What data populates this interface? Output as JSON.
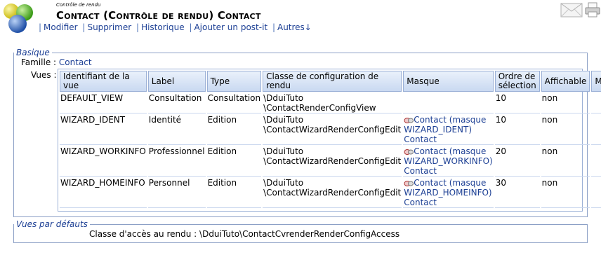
{
  "header": {
    "category": "Contrôle de rendu",
    "title": "Contact (Contrôle de rendu) Contact"
  },
  "menu": [
    "Modifier",
    "Supprimer",
    "Historique",
    "Ajouter un post-it",
    "Autres↓"
  ],
  "icons": {
    "logo": "family-logo-icon",
    "mail": "mail-icon",
    "print": "print-icon",
    "mask": "mask-icon"
  },
  "basique": {
    "legend": "Basique",
    "famille_label": "Famille :",
    "famille_value": "Contact",
    "vues_label": "Vues :",
    "columns": [
      "Identifiant de la vue",
      "Label",
      "Type",
      "Classe de configuration de rendu",
      "Masque",
      "Ordre de sélection",
      "Affichable",
      "Menu"
    ],
    "rows": [
      {
        "id": "DEFAULT_VIEW",
        "label": "Consultation",
        "type": "Consultation",
        "classe1": "\\DduiTuto",
        "classe2": "\\ContactRenderConfigView",
        "masque1": "",
        "masque2": "",
        "masque3": "",
        "ordre": "10",
        "affichable": "non",
        "menu": ""
      },
      {
        "id": "WIZARD_IDENT",
        "label": "Identité",
        "type": "Edition",
        "classe1": "\\DduiTuto",
        "classe2": "\\ContactWizardRenderConfigEdit",
        "masque1": "Contact (masque",
        "masque2": "WIZARD_IDENT)",
        "masque3": "Contact",
        "ordre": "10",
        "affichable": "non",
        "menu": ""
      },
      {
        "id": "WIZARD_WORKINFO",
        "label": "Professionnel",
        "type": "Edition",
        "classe1": "\\DduiTuto",
        "classe2": "\\ContactWizardRenderConfigEdit",
        "masque1": "Contact (masque",
        "masque2": "WIZARD_WORKINFO)",
        "masque3": "Contact",
        "ordre": "20",
        "affichable": "non",
        "menu": ""
      },
      {
        "id": "WIZARD_HOMEINFO",
        "label": "Personnel",
        "type": "Edition",
        "classe1": "\\DduiTuto",
        "classe2": "\\ContactWizardRenderConfigEdit",
        "masque1": "Contact (masque",
        "masque2": "WIZARD_HOMEINFO)",
        "masque3": "Contact",
        "ordre": "30",
        "affichable": "non",
        "menu": ""
      }
    ]
  },
  "defauts": {
    "legend": "Vues par défauts",
    "acces_label": "Classe d'accès au rendu :",
    "acces_value": "\\DduiTuto\\ContactCvrenderRenderConfigAccess"
  }
}
